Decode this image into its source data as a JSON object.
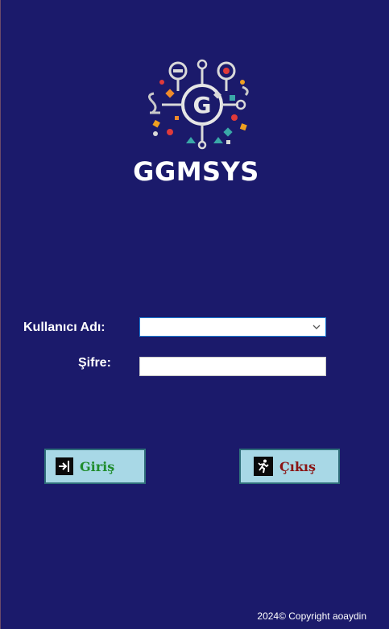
{
  "brand": {
    "name": "GGMSYS"
  },
  "form": {
    "username_label": "Kullanıcı Adı:",
    "username_value": "",
    "password_label": "Şifre:",
    "password_value": ""
  },
  "buttons": {
    "login_label": "Giriş",
    "exit_label": "Çıkış"
  },
  "footer": {
    "copyright": "2024© Copyright aoaydin"
  },
  "colors": {
    "background": "#1b1a6b",
    "button_bg": "#a8d8e6",
    "login_text": "#1f8c2c",
    "exit_text": "#8a1414"
  },
  "icons": {
    "login": "login-arrow-icon",
    "exit": "running-exit-icon",
    "combo": "chevron-down-icon"
  }
}
